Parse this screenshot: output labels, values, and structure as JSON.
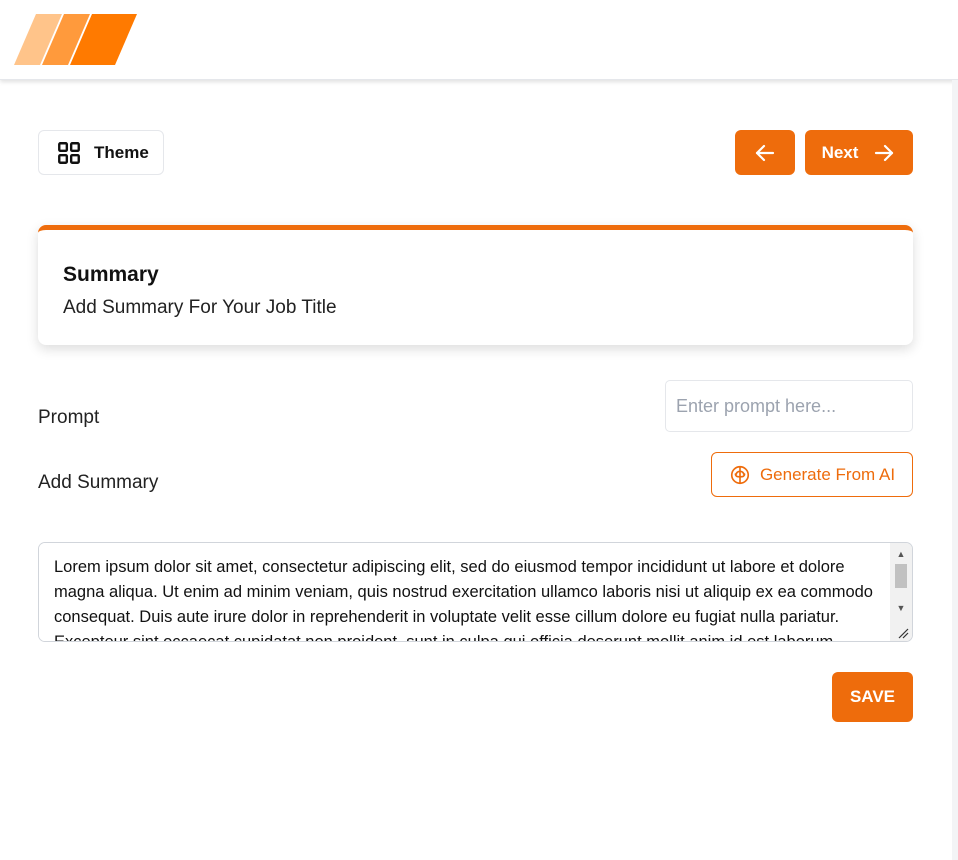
{
  "brand": {
    "logo_icon": "striped-parallelogram-logo",
    "colors": [
      "#ffc48a",
      "#ff9a3c",
      "#ff7a00"
    ]
  },
  "toolbar": {
    "theme_label": "Theme",
    "theme_icon": "grid-icon",
    "back_icon": "arrow-left-icon",
    "next_label": "Next",
    "next_icon": "arrow-right-icon"
  },
  "card": {
    "title": "Summary",
    "subtitle": "Add Summary For Your Job Title"
  },
  "form": {
    "prompt_label": "Prompt",
    "prompt_placeholder": "Enter prompt here...",
    "prompt_value": "",
    "summary_label": "Add Summary",
    "ai_button_label": "Generate From AI",
    "ai_button_icon": "brain-icon",
    "summary_value": "Lorem ipsum dolor sit amet, consectetur adipiscing elit, sed do eiusmod tempor incididunt ut labore et dolore magna aliqua. Ut enim ad minim veniam, quis nostrud exercitation ullamco laboris nisi ut aliquip ex ea commodo consequat. Duis aute irure dolor in reprehenderit in voluptate velit esse cillum dolore eu fugiat nulla pariatur. Excepteur sint occaecat cupidatat non proident, sunt in culpa qui officia deserunt mollit anim id est laborum.",
    "save_label": "SAVE"
  },
  "theme": {
    "accent": "#ee6c0c"
  }
}
